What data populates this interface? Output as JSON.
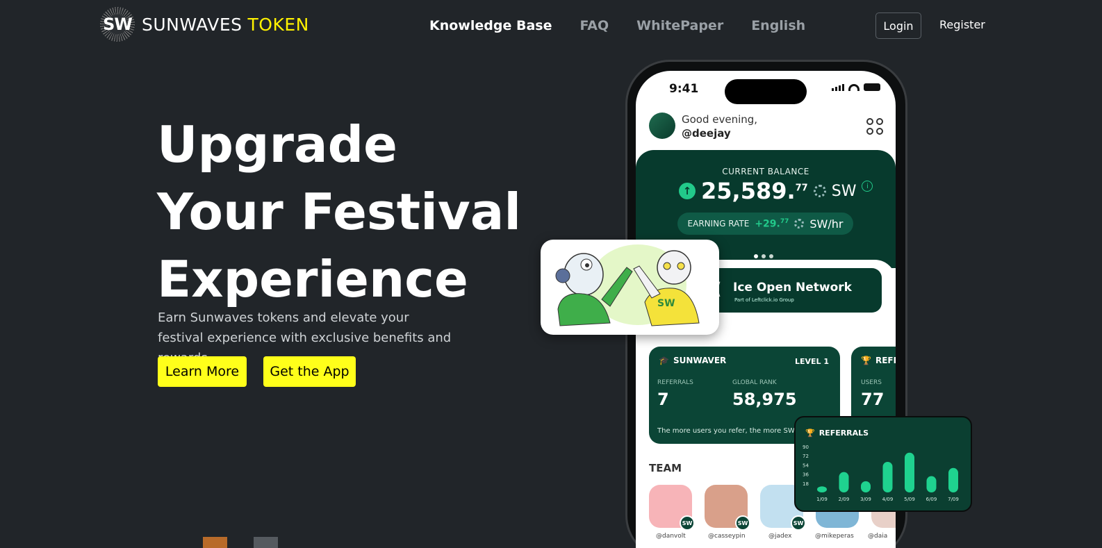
{
  "nav": {
    "logo_mark": "SW",
    "logo_word1": "SUNWAVES",
    "logo_word2": "TOKEN",
    "links": [
      "Knowledge Base",
      "FAQ",
      "WhitePaper",
      "English"
    ],
    "login": "Login",
    "register": "Register"
  },
  "hero": {
    "title_line1": "Upgrade",
    "title_line2": "Your Festival",
    "title_line3": "Experience",
    "subtitle": "Earn Sunwaves tokens and elevate your festival experience with exclusive benefits and rewards.",
    "learn_more": "Learn More",
    "get_app": "Get the App"
  },
  "phone": {
    "time": "9:41",
    "greeting": "Good evening,",
    "username": "@deejay",
    "balance_label": "CURRENT BALANCE",
    "balance_main": "25,589.",
    "balance_decimal": "77",
    "balance_unit": "SW",
    "earning_label": "EARNING RATE",
    "earning_value": "+29.",
    "earning_decimal": "77",
    "earning_unit": "SW/hr",
    "ion_title": "Ice Open Network",
    "ion_sub": "Part of Leftclick.io Group",
    "sunwaver_title": "SUNWAVER",
    "level": "LEVEL 1",
    "referrals_label": "REFERRALS",
    "referrals_value": "7",
    "rank_label": "GLOBAL RANK",
    "rank_value": "58,975",
    "footnote": "The more users you refer, the more",
    "footnote_unit": "SW",
    "ref_card_title": "REFE",
    "users_label": "USERS",
    "users_value": "77",
    "team_label": "TEAM",
    "team_badge": "SW",
    "team": [
      "@danvolt",
      "@casseypin",
      "@jadex",
      "@mikeperas",
      "@daia"
    ]
  },
  "chart_data": {
    "type": "bar",
    "title": "REFERRALS",
    "categories": [
      "1/09",
      "2/09",
      "3/09",
      "4/09",
      "5/09",
      "6/09",
      "7/09"
    ],
    "values": [
      12,
      40,
      22,
      60,
      78,
      32,
      48
    ],
    "yticks": [
      90,
      72,
      54,
      36,
      18
    ],
    "ylim": [
      0,
      90
    ],
    "color": "#1fd28f"
  }
}
